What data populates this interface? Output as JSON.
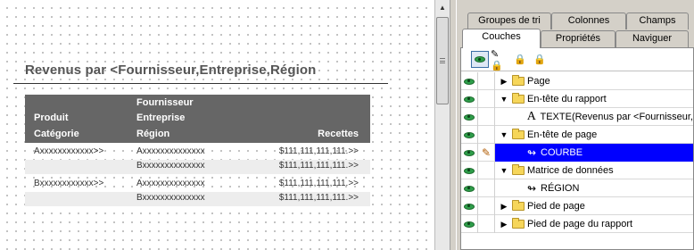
{
  "report": {
    "title": "Revenus par <Fournisseur,Entreprise,Région",
    "columns": {
      "col1_line1": "Produit",
      "col1_line2": "Catégorie",
      "col2_line1": "Fournisseur",
      "col2_line2": "Entreprise",
      "col2_line3": "Région",
      "col4": "Recettes"
    },
    "rows": [
      {
        "c1": "Axxxxxxxxxxxx>>",
        "c2": "Axxxxxxxxxxxxxx",
        "c4": "$111,111,111,111.>>"
      },
      {
        "c1": "",
        "c2": "Bxxxxxxxxxxxxxx",
        "c4": "$111,111,111,111.>>"
      },
      {
        "c1": "Bxxxxxxxxxxxx>>",
        "c2": "Axxxxxxxxxxxxxx",
        "c4": "$111,111,111,111.>>"
      },
      {
        "c1": "",
        "c2": "Bxxxxxxxxxxxxxx",
        "c4": "$111,111,111,111.>>"
      }
    ]
  },
  "tabs": {
    "row1": [
      "Groupes de tri",
      "Colonnes",
      "Champs"
    ],
    "row2": [
      "Couches",
      "Propriétés",
      "Naviguer"
    ],
    "active": "Couches"
  },
  "toolbar": {
    "icons": [
      "eye-icon",
      "pencil-lock-icon",
      "lock-stack-icon",
      "lock-icon"
    ]
  },
  "layers": [
    {
      "label": "Page",
      "icon": "folder",
      "expander": "collapsed",
      "indent": 0
    },
    {
      "label": "En-tête du rapport",
      "icon": "folder",
      "expander": "expanded",
      "indent": 0
    },
    {
      "label": "TEXTE(Revenus par <Fournisseur,",
      "icon": "text",
      "expander": "none",
      "indent": 1
    },
    {
      "label": "En-tête de page",
      "icon": "folder",
      "expander": "expanded",
      "indent": 0
    },
    {
      "label": "COURBE",
      "icon": "curve",
      "expander": "none",
      "indent": 1,
      "selected": true,
      "edit": true
    },
    {
      "label": "Matrice de données",
      "icon": "folder",
      "expander": "expanded",
      "indent": 0
    },
    {
      "label": "RÉGION",
      "icon": "curve",
      "expander": "none",
      "indent": 1
    },
    {
      "label": "Pied de page",
      "icon": "folder",
      "expander": "collapsed",
      "indent": 0
    },
    {
      "label": "Pied de page du rapport",
      "icon": "folder",
      "expander": "collapsed",
      "indent": 0
    }
  ],
  "colors": {
    "selection": "#0000ff",
    "table_header": "#666666",
    "eye": "#2e9e4a"
  }
}
